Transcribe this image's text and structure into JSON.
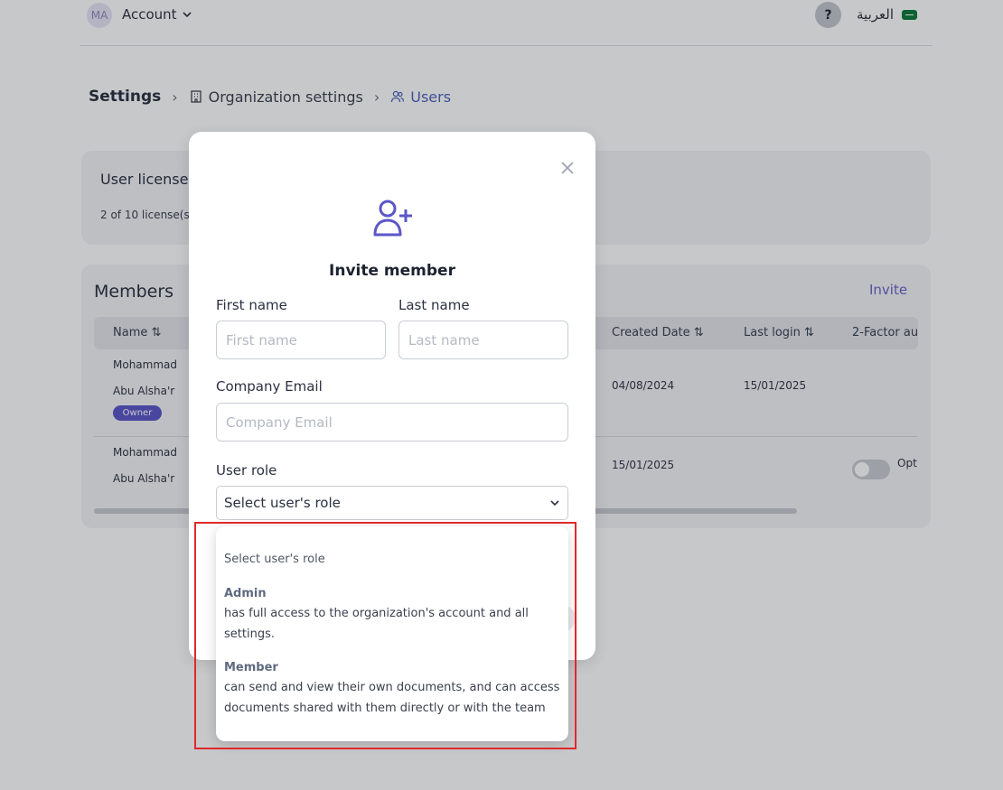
{
  "topbar": {
    "avatar_initials": "MA",
    "account_label": "Account",
    "help_label": "?",
    "language_label": "العربية"
  },
  "breadcrumb": {
    "root": "Settings",
    "items": [
      {
        "label": "Organization settings",
        "icon": "building-icon"
      },
      {
        "label": "Users",
        "icon": "users-icon"
      }
    ]
  },
  "licenses": {
    "title": "User licenses",
    "subtitle": "2 of 10 license(s"
  },
  "members": {
    "title": "Members",
    "invite_label": "Invite",
    "columns": [
      "Name",
      "Created Date",
      "Last login",
      "2-Factor au"
    ],
    "rows": [
      {
        "first": "Mohammad",
        "last": "Abu Alsha'r",
        "badge": "Owner",
        "created": "04/08/2024",
        "last_login": "15/01/2025",
        "twofa": ""
      },
      {
        "first": "Mohammad",
        "last": "Abu Alsha'r",
        "badge": "",
        "created": "15/01/2025",
        "last_login": "",
        "twofa": "Opt"
      }
    ]
  },
  "modal": {
    "title": "Invite member",
    "icon": "user-plus-icon",
    "first_name_label": "First name",
    "first_name_placeholder": "First name",
    "last_name_label": "Last name",
    "last_name_placeholder": "Last name",
    "email_label": "Company Email",
    "email_placeholder": "Company Email",
    "role_label": "User role",
    "role_selected": "Select user's role"
  },
  "dropdown": {
    "placeholder": "Select user's role",
    "options": [
      {
        "name": "Admin",
        "description": "has full access to the organization's account and all settings."
      },
      {
        "name": "Member",
        "description": "can send and view their own documents, and can access documents shared with them directly or with the team"
      }
    ]
  },
  "colors": {
    "accent": "#6a64c8",
    "owner_badge": "#5b57c9",
    "highlight_border": "#e0282b"
  }
}
